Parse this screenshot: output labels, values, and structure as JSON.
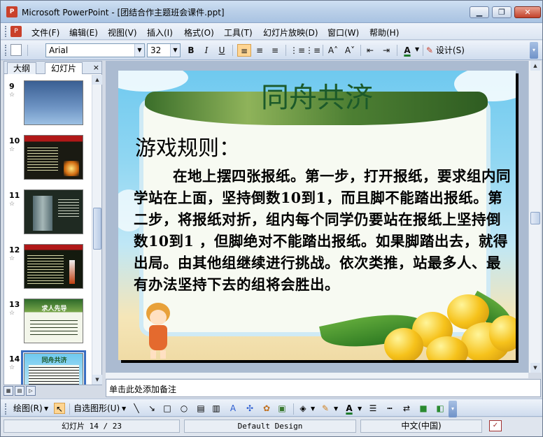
{
  "window": {
    "title": "Microsoft PowerPoint - [团结合作主题班会课件.ppt]",
    "app_icon_label": "P"
  },
  "window_controls": {
    "minimize": "▁",
    "restore": "❐",
    "close": "✕"
  },
  "menubar": {
    "items": [
      "文件(F)",
      "编辑(E)",
      "视图(V)",
      "插入(I)",
      "格式(O)",
      "工具(T)",
      "幻灯片放映(D)",
      "窗口(W)",
      "帮助(H)"
    ]
  },
  "toolbar": {
    "font_name": "Arial",
    "font_size": "32",
    "bold": "B",
    "italic": "I",
    "underline": "U",
    "align_left": "≡",
    "align_center": "≡",
    "align_right": "≡",
    "numbering": "⋮≡",
    "bullets": "⋮≡",
    "increase_font": "A˄",
    "decrease_font": "A˅",
    "decrease_indent": "⇤",
    "increase_indent": "⇥",
    "font_color": "A",
    "design": "设计(S)"
  },
  "outline_pane": {
    "tabs": [
      "大纲",
      "幻灯片"
    ],
    "active_tab": "幻灯片",
    "close": "×",
    "thumbnails": [
      {
        "number": "9",
        "star": "☆",
        "title": ""
      },
      {
        "number": "10",
        "star": "☆",
        "title": ""
      },
      {
        "number": "11",
        "star": "☆",
        "title": ""
      },
      {
        "number": "12",
        "star": "☆",
        "title": ""
      },
      {
        "number": "13",
        "star": "☆",
        "title": "求人先导"
      },
      {
        "number": "14",
        "star": "☆",
        "title": "同舟共济"
      }
    ],
    "selected": "14"
  },
  "slide": {
    "title": "同舟共济",
    "heading": "游戏规则：",
    "body": "在地上摆四张报纸。第一步，打开报纸，要求组内同学站在上面，坚持倒数10到1，而且脚不能踏出报纸。第二步，将报纸对折，组内每个同学仍要站在报纸上坚持倒数10到1 ，但脚绝对不能踏出报纸。如果脚踏出去，就得出局。由其他组继续进行挑战。依次类推，站最多人、最有办法坚持下去的组将会胜出。",
    "colors": {
      "title": "#1c5a2a",
      "sky": "#6fc9ef",
      "frame": "#f7faf2"
    }
  },
  "notes": {
    "placeholder": "单击此处添加备注"
  },
  "drawing_toolbar": {
    "draw": "绘图(R)",
    "autoshapes": "自选图形(U)",
    "icons": [
      "line-icon",
      "arrow-icon",
      "rectangle-icon",
      "oval-icon",
      "textbox-icon",
      "vertical-textbox-icon",
      "wordart-icon",
      "diagram-icon",
      "clipart-icon",
      "picture-icon",
      "fill-color-icon",
      "line-color-icon",
      "font-color-icon",
      "line-style-icon",
      "dash-style-icon",
      "arrow-style-icon",
      "shadow-icon",
      "3d-icon"
    ]
  },
  "statusbar": {
    "slide": "幻灯片 14 / 23",
    "design": "Default Design",
    "language": "中文(中国)"
  }
}
